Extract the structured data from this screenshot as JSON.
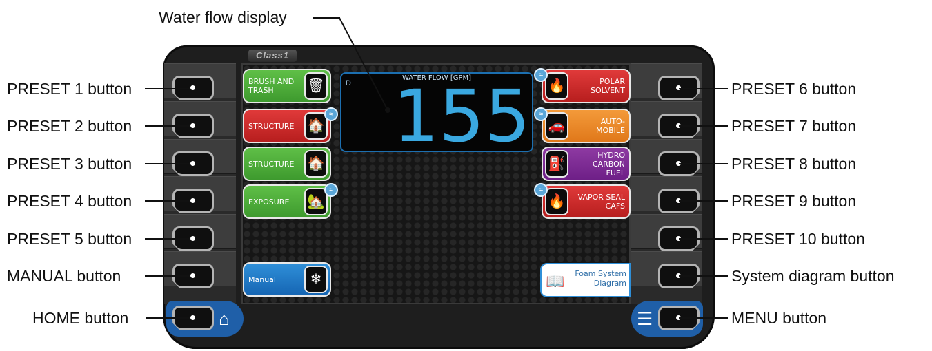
{
  "device": {
    "brand": "Class1",
    "water_flow": {
      "title": "WATER FLOW [GPM]",
      "indicator": "D",
      "value": "155"
    },
    "presets_left": [
      {
        "label": "BRUSH AND\nTRASH",
        "color": "#4caf3a",
        "icon": "trash-fire-icon"
      },
      {
        "label": "STRUCTURE",
        "color": "#d32f2f",
        "icon": "house-fire-icon",
        "foam": true
      },
      {
        "label": "STRUCTURE",
        "color": "#4caf3a",
        "icon": "house-fire-icon"
      },
      {
        "label": "EXPOSURE",
        "color": "#4caf3a",
        "icon": "exposure-fire-icon",
        "foam": true
      }
    ],
    "presets_right": [
      {
        "label": "POLAR\nSOLVENT",
        "color": "#d32f2f",
        "icon": "flask-fire-icon",
        "foam": true
      },
      {
        "label": "AUTO-\nMOBILE",
        "color": "#ef8a2a",
        "icon": "car-fire-icon",
        "foam": true
      },
      {
        "label": "HYDRO\nCARBON\nFUEL",
        "color": "#7b2a93",
        "icon": "fuel-pump-icon"
      },
      {
        "label": "VAPOR SEAL\nCAFS",
        "color": "#d32f2f",
        "icon": "flame-icon",
        "foam": true
      }
    ],
    "manual": {
      "label": "Manual",
      "icon": "nozzle-icon"
    },
    "diagram": {
      "label": "Foam System\nDiagram",
      "icon": "book-icon"
    }
  },
  "callouts": {
    "water_flow": "Water flow display",
    "preset1": "PRESET 1 button",
    "preset2": "PRESET 2 button",
    "preset3": "PRESET 3 button",
    "preset4": "PRESET 4 button",
    "preset5": "PRESET 5 button",
    "manual": "MANUAL button",
    "home": "HOME button",
    "preset6": "PRESET 6 button",
    "preset7": "PRESET 7 button",
    "preset8": "PRESET 8 button",
    "preset9": "PRESET 9 button",
    "preset10": "PRESET 10 button",
    "system_diagram": "System diagram button",
    "menu": "MENU button"
  }
}
